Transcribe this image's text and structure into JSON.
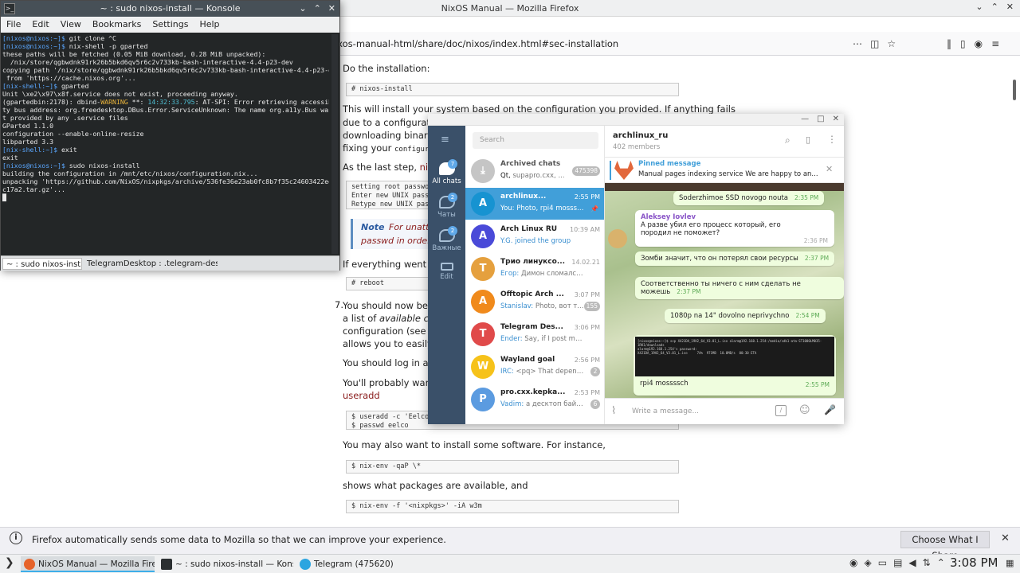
{
  "firefox": {
    "title": "NixOS Manual — Mozilla Firefox",
    "url": "ixos-manual-html/share/doc/nixos/index.html#sec-installation",
    "content": {
      "step_do": "Do the installation:",
      "cmd_install": "# nixos-install",
      "p1": "This will install your system based on the configuration you provided. If anything fails",
      "p1b": "due to a configuratio",
      "p1c": "downloading binaries",
      "p1d": "fixing your",
      "p1d_code": "configurat",
      "p2": "As the last step,",
      "p2_code": "nixos",
      "pre_passwd": "setting root passwor\nEnter new UNIX passw\nRetype new UNIX pass",
      "note_label": "Note",
      "note_text": "For unatter",
      "note_text2": "passwd in order to",
      "p3": "If everything went we",
      "cmd_reboot": "# reboot",
      "step7_num": "7.",
      "step7": "You should now be ab",
      "p4b": "a list of",
      "p4b_em": "available conf",
      "p4c": "configuration (see",
      "p4c_link": "Ch",
      "p4d": "allows you to easily ro",
      "p5": "You should log in and",
      "p6": "You'll probably want t",
      "p6_code": "useradd",
      "pre_user": "$ useradd -c 'Eelco D\n$ passwd eelco",
      "p7": "You may also want to install some software. For instance,",
      "cmd_nixenv": "$ nix-env -qaP \\*",
      "p8": "shows what packages are available, and",
      "cmd_w3m": "$ nix-env -f '<nixpkgs>' -iA w3m"
    },
    "notification": {
      "text": "Firefox automatically sends some data to Mozilla so that we can improve your experience.",
      "button": "Choose What I Share"
    }
  },
  "konsole": {
    "title": "~ : sudo nixos-install — Konsole",
    "menu": [
      "File",
      "Edit",
      "View",
      "Bookmarks",
      "Settings",
      "Help"
    ],
    "lines": [
      {
        "p": "[nixos@nixos:~]$",
        "t": " git clone ^C"
      },
      {
        "t": ""
      },
      {
        "p": "[nixos@nixos:~]$",
        "t": " nix-shell -p gparted"
      },
      {
        "t": "these paths will be fetched (0.05 MiB download, 0.28 MiB unpacked):"
      },
      {
        "t": "  /nix/store/qgbwdnk91rk26b5bkd6qv5r6c2v733kb-bash-interactive-4.4-p23-dev"
      },
      {
        "t": "copying path '/nix/store/qgbwdnk91rk26b5bkd6qv5r6c2v733kb-bash-interactive-4.4-p23-dev'"
      },
      {
        "t": " from 'https://cache.nixos.org'..."
      },
      {
        "t": ""
      },
      {
        "p": "[nix-shell:~]$",
        "t": " gparted"
      },
      {
        "t": "Unit \\xe2\\x97\\x8f.service does not exist, proceeding anyway."
      },
      {
        "t": ""
      },
      {
        "t": "(gpartedbin:2178): dbind-",
        "w": "WARNING",
        "t2": " **: ",
        "ts": "14:32:33.795",
        "t3": ": AT-SPI: Error retrieving accessibili"
      },
      {
        "t": "ty bus address: org.freedesktop.DBus.Error.ServiceUnknown: The name org.a11y.Bus was no"
      },
      {
        "t": "t provided by any .service files"
      },
      {
        "t": "GParted 1.1.0"
      },
      {
        "t": "configuration --enable-online-resize"
      },
      {
        "t": "libparted 3.3"
      },
      {
        "t": ""
      },
      {
        "p": "[nix-shell:~]$",
        "t": " exit"
      },
      {
        "t": "exit"
      },
      {
        "t": ""
      },
      {
        "p": "[nixos@nixos:~]$",
        "t": " sudo nixos-install"
      },
      {
        "t": "building the configuration in /mnt/etc/nixos/configuration.nix..."
      },
      {
        "t": "unpacking 'https://github.com/NixOS/nixpkgs/archive/536fe36e23ab0fc8b7f35c24603422eee9f"
      },
      {
        "t": "c17a2.tar.gz'..."
      },
      {
        "t": "█"
      }
    ],
    "tabs": [
      "~ : sudo nixos-install",
      "TelegramDesktop : .telegram-deskt"
    ]
  },
  "telegram": {
    "sidebar": [
      {
        "label": "All chats",
        "badge": "7"
      },
      {
        "label": "Чаты",
        "badge": "2"
      },
      {
        "label": "Важные",
        "badge": "2"
      },
      {
        "label": "Edit",
        "badge": ""
      }
    ],
    "search_placeholder": "Search",
    "chats": [
      {
        "name": "Archived chats",
        "time": "",
        "preview_from": "Qt,",
        "preview": "supapro.cxx, ...",
        "badge": "475398",
        "color": "#c5c5c5",
        "letter": "⤓"
      },
      {
        "name": "archlinux...",
        "time": "2:55 PM",
        "preview_from": "You:",
        "preview": "Photo, rpi4 mossss...",
        "badge": "",
        "color": "#1793d1",
        "letter": "A"
      },
      {
        "name": "Arch Linux RU",
        "time": "10:39 AM",
        "preview_from": "",
        "preview": "Y.G. joined the group",
        "badge": "",
        "color": "#4a4ad8",
        "letter": "A"
      },
      {
        "name": "Трио линуксо...",
        "time": "14.02.21",
        "preview_from": "Егор:",
        "preview": "Димон сломался,...",
        "badge": "",
        "color": "#e5a03e",
        "letter": "Т"
      },
      {
        "name": "Offtopic Arch ...",
        "time": "3:07 PM",
        "preview_from": "Stanislav:",
        "preview": "Photo, вот т...",
        "badge": "155",
        "color": "#f08a1c",
        "letter": "A"
      },
      {
        "name": "Telegram Des...",
        "time": "3:06 PM",
        "preview_from": "Ender:",
        "preview": "Say, if I post my own ...",
        "badge": "",
        "color": "#e04a4a",
        "letter": "T"
      },
      {
        "name": "Wayland goal",
        "time": "2:56 PM",
        "preview_from": "IRC:",
        "preview": "<pq> That depends...",
        "badge": "2",
        "color": "#f6c21a",
        "letter": "W"
      },
      {
        "name": "pro.cxx.kepka...",
        "time": "2:53 PM",
        "preview_from": "Vadim:",
        "preview": "а десктоп байт...",
        "badge": "6",
        "color": "#5b9be0",
        "letter": "P"
      }
    ],
    "chat_title": "archlinux_ru",
    "chat_members": "402 members",
    "pinned_label": "Pinned message",
    "pinned_text": "Manual pages indexing service  We are happy to an...",
    "messages": [
      {
        "text": "Soderzhimoe SSD novogo nouta",
        "time": "2:35 PM"
      },
      {
        "author": "Aleksey Iovlev",
        "text": "А разве убил его процесс который, его породил не поможет?",
        "time": "2:36 PM"
      },
      {
        "text": "Зомби значит, что он потерял свои ресурсы",
        "time": "2:37 PM"
      },
      {
        "text": "Соответственно ты ничего с ним сделать не можешь",
        "time": "2:37 PM"
      },
      {
        "text": "1080p na 14\" dovolno neprivychno",
        "time": "2:54 PM"
      },
      {
        "text": "rpi4 mossssch",
        "time": "2:55 PM"
      }
    ],
    "input_placeholder": "Write a message..."
  },
  "taskbar": {
    "tasks": [
      "NixOS Manual — Mozilla Firefox",
      "~ : sudo nixos-install — Konsole",
      "Telegram (475620)"
    ],
    "clock": "3:08 PM"
  }
}
